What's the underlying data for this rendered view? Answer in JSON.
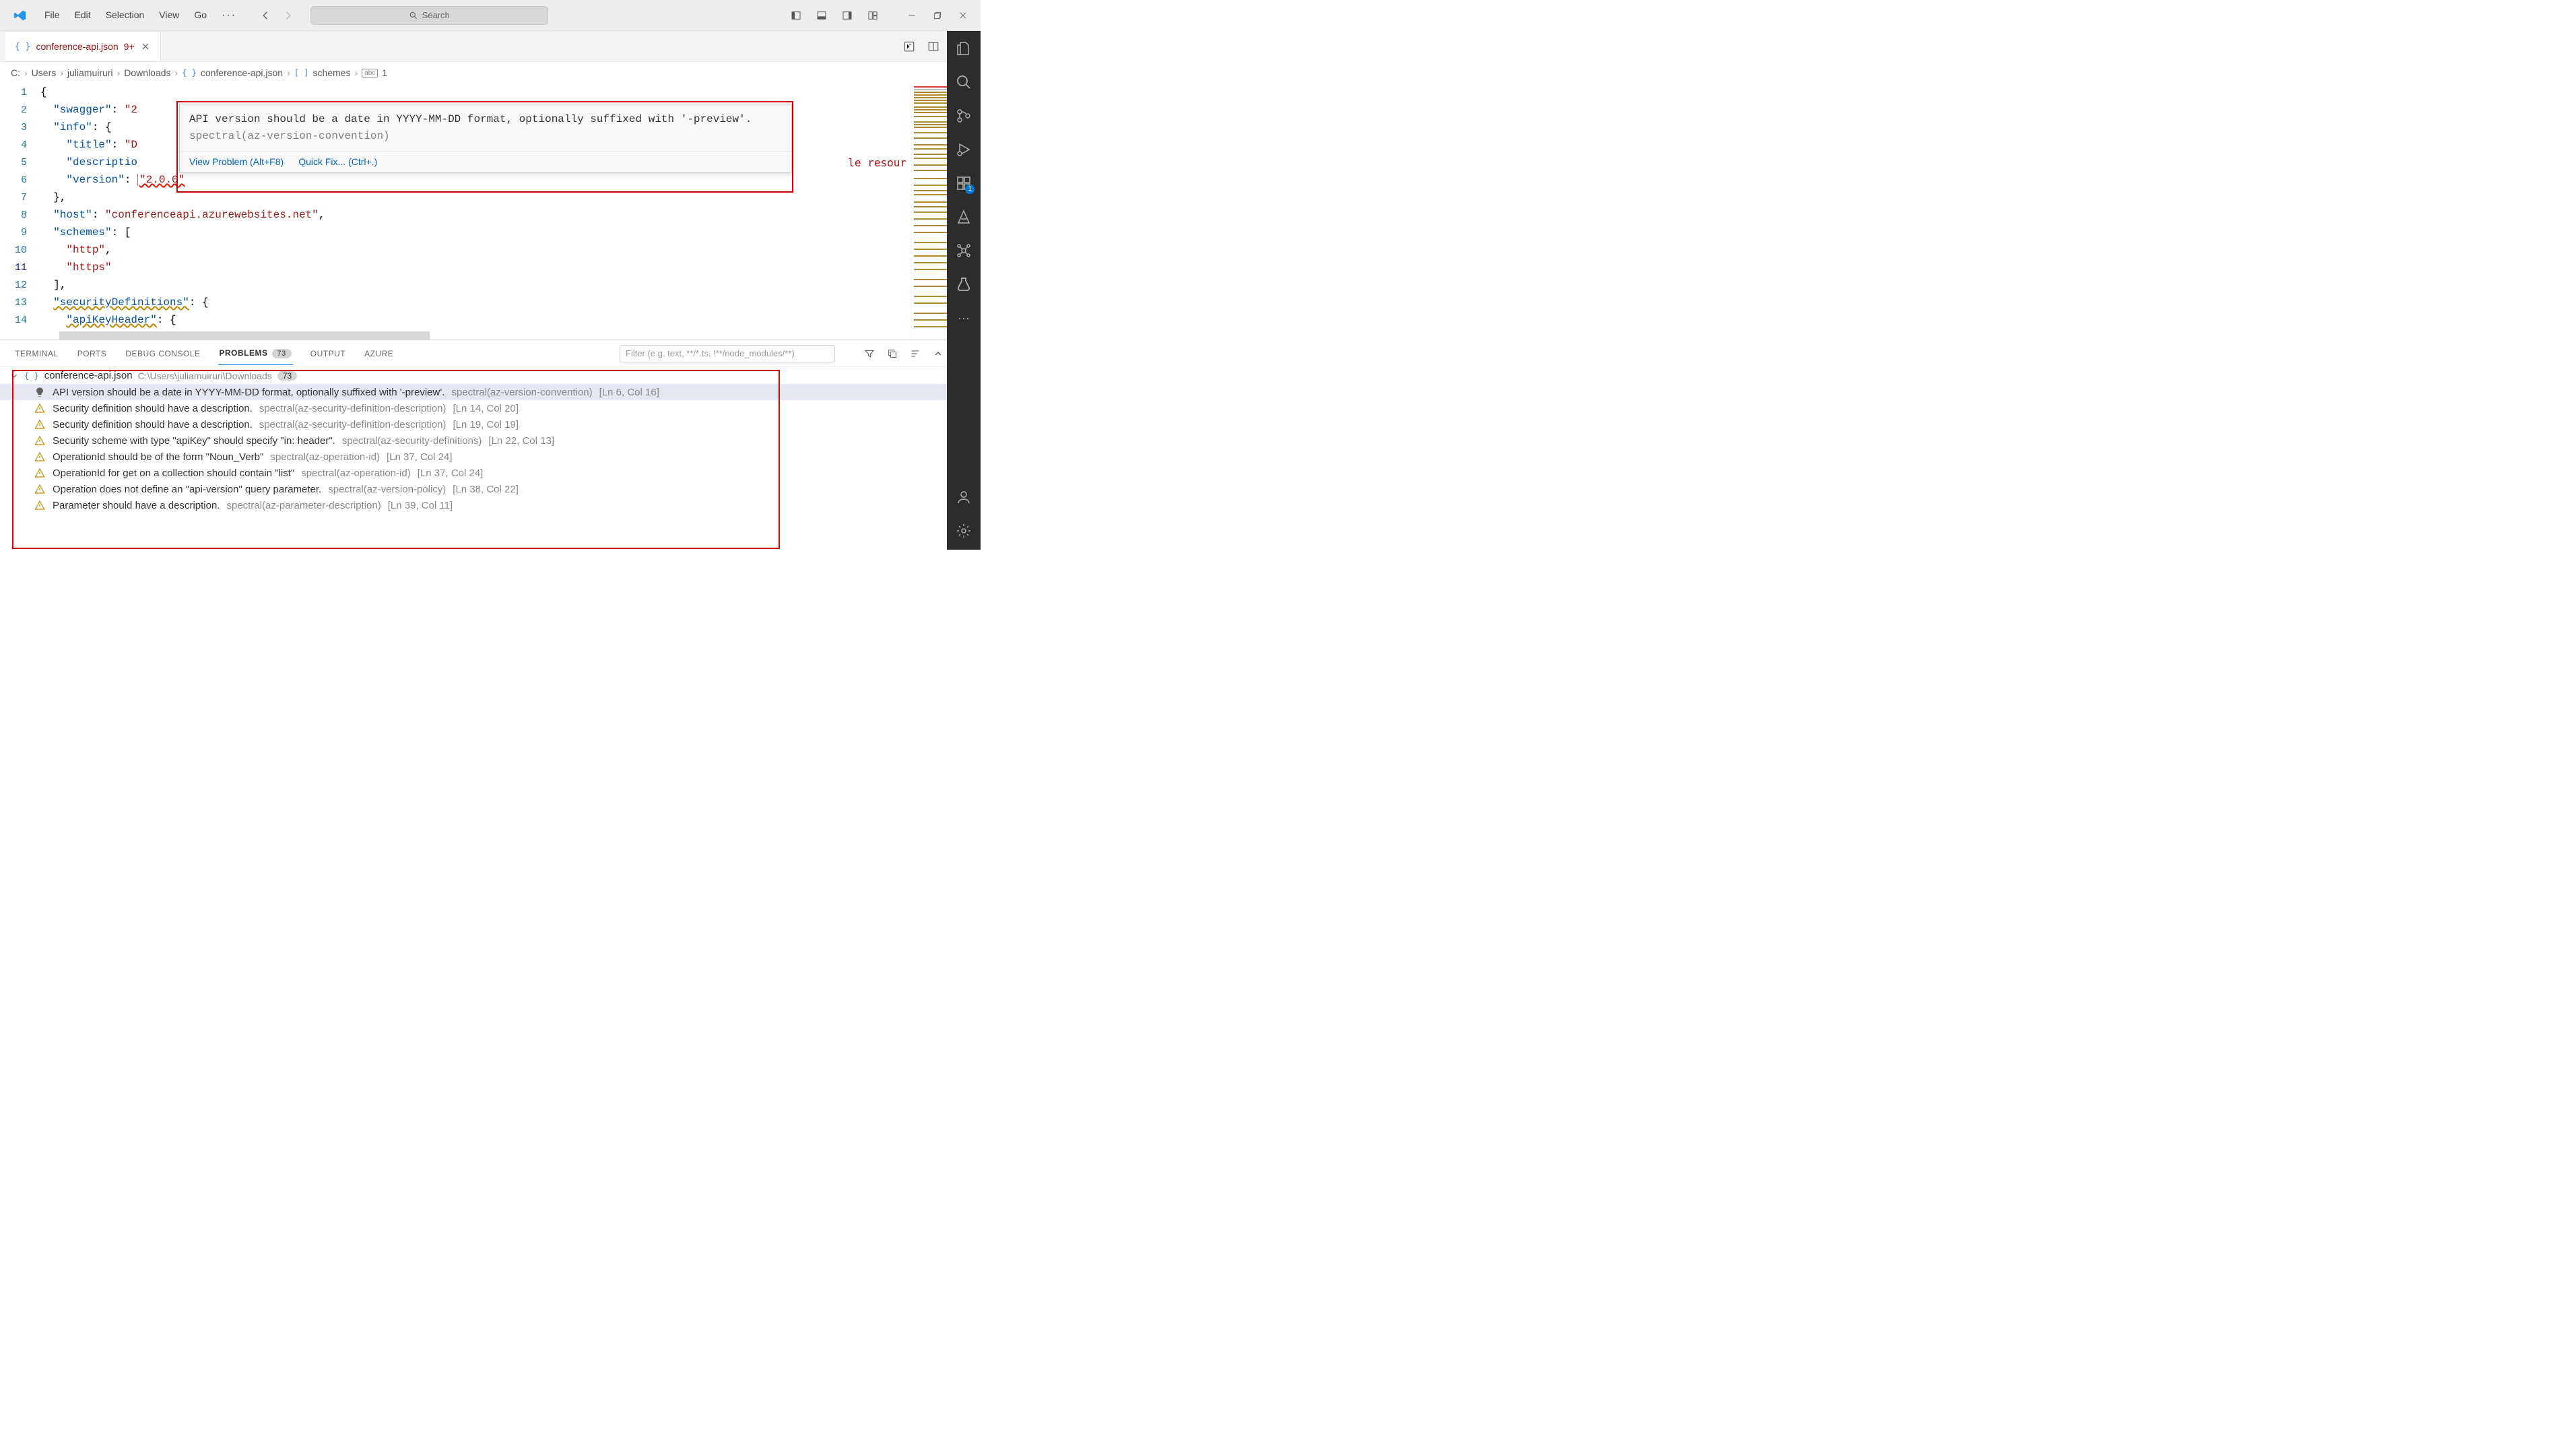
{
  "titlebar": {
    "menus": [
      "File",
      "Edit",
      "Selection",
      "View",
      "Go"
    ],
    "search_placeholder": "Search"
  },
  "tab": {
    "name": "conference-api.json",
    "badge": "9+"
  },
  "breadcrumb": {
    "parts": [
      "C:",
      "Users",
      "juliamuiruri",
      "Downloads",
      "conference-api.json",
      "schemes",
      "1"
    ]
  },
  "editor": {
    "lines": [
      {
        "n": 1,
        "code": "{"
      },
      {
        "n": 2,
        "code": "  \"swagger\": \"2"
      },
      {
        "n": 3,
        "code": "  \"info\": {"
      },
      {
        "n": 4,
        "code": "    \"title\": \"D"
      },
      {
        "n": 5,
        "code": "    \"descriptio"
      },
      {
        "n": 6,
        "code": "    \"version\": \"2.0.0\""
      },
      {
        "n": 7,
        "code": "  },"
      },
      {
        "n": 8,
        "code": "  \"host\": \"conferenceapi.azurewebsites.net\","
      },
      {
        "n": 9,
        "code": "  \"schemes\": ["
      },
      {
        "n": 10,
        "code": "    \"http\","
      },
      {
        "n": 11,
        "code": "    \"https\""
      },
      {
        "n": 12,
        "code": "  ],"
      },
      {
        "n": 13,
        "code": "  \"securityDefinitions\": {"
      },
      {
        "n": 14,
        "code": "    \"apiKeyHeader\": {"
      }
    ],
    "trailing_text": "le resour"
  },
  "hover": {
    "message": "API version should be a date in YYYY-MM-DD format, optionally suffixed with '-preview'.",
    "rule": "spectral(az-version-convention)",
    "action_view": "View Problem (Alt+F8)",
    "action_fix": "Quick Fix... (Ctrl+.)"
  },
  "panel": {
    "tabs": [
      "TERMINAL",
      "PORTS",
      "DEBUG CONSOLE",
      "PROBLEMS",
      "OUTPUT",
      "AZURE"
    ],
    "active": "PROBLEMS",
    "count": "73",
    "filter_placeholder": "Filter (e.g. text, **/*.ts, !**/node_modules/**)",
    "file": {
      "name": "conference-api.json",
      "path": "C:\\Users\\juliamuiruri\\Downloads",
      "count": "73"
    },
    "problems": [
      {
        "sev": "hint",
        "msg": "API version should be a date in YYYY-MM-DD format, optionally suffixed with '-preview'.",
        "rule": "spectral(az-version-convention)",
        "loc": "[Ln 6, Col 16]",
        "selected": true
      },
      {
        "sev": "warn",
        "msg": "Security definition should have a description.",
        "rule": "spectral(az-security-definition-description)",
        "loc": "[Ln 14, Col 20]"
      },
      {
        "sev": "warn",
        "msg": "Security definition should have a description.",
        "rule": "spectral(az-security-definition-description)",
        "loc": "[Ln 19, Col 19]"
      },
      {
        "sev": "warn",
        "msg": "Security scheme with type \"apiKey\" should specify \"in: header\".",
        "rule": "spectral(az-security-definitions)",
        "loc": "[Ln 22, Col 13]"
      },
      {
        "sev": "warn",
        "msg": "OperationId should be of the form \"Noun_Verb\"",
        "rule": "spectral(az-operation-id)",
        "loc": "[Ln 37, Col 24]"
      },
      {
        "sev": "warn",
        "msg": "OperationId for get on a collection should contain \"list\"",
        "rule": "spectral(az-operation-id)",
        "loc": "[Ln 37, Col 24]"
      },
      {
        "sev": "warn",
        "msg": "Operation does not define an \"api-version\" query parameter.",
        "rule": "spectral(az-version-policy)",
        "loc": "[Ln 38, Col 22]"
      },
      {
        "sev": "warn",
        "msg": "Parameter should have a description.",
        "rule": "spectral(az-parameter-description)",
        "loc": "[Ln 39, Col 11]"
      }
    ]
  },
  "activitybar": {
    "ext_badge": "1"
  }
}
